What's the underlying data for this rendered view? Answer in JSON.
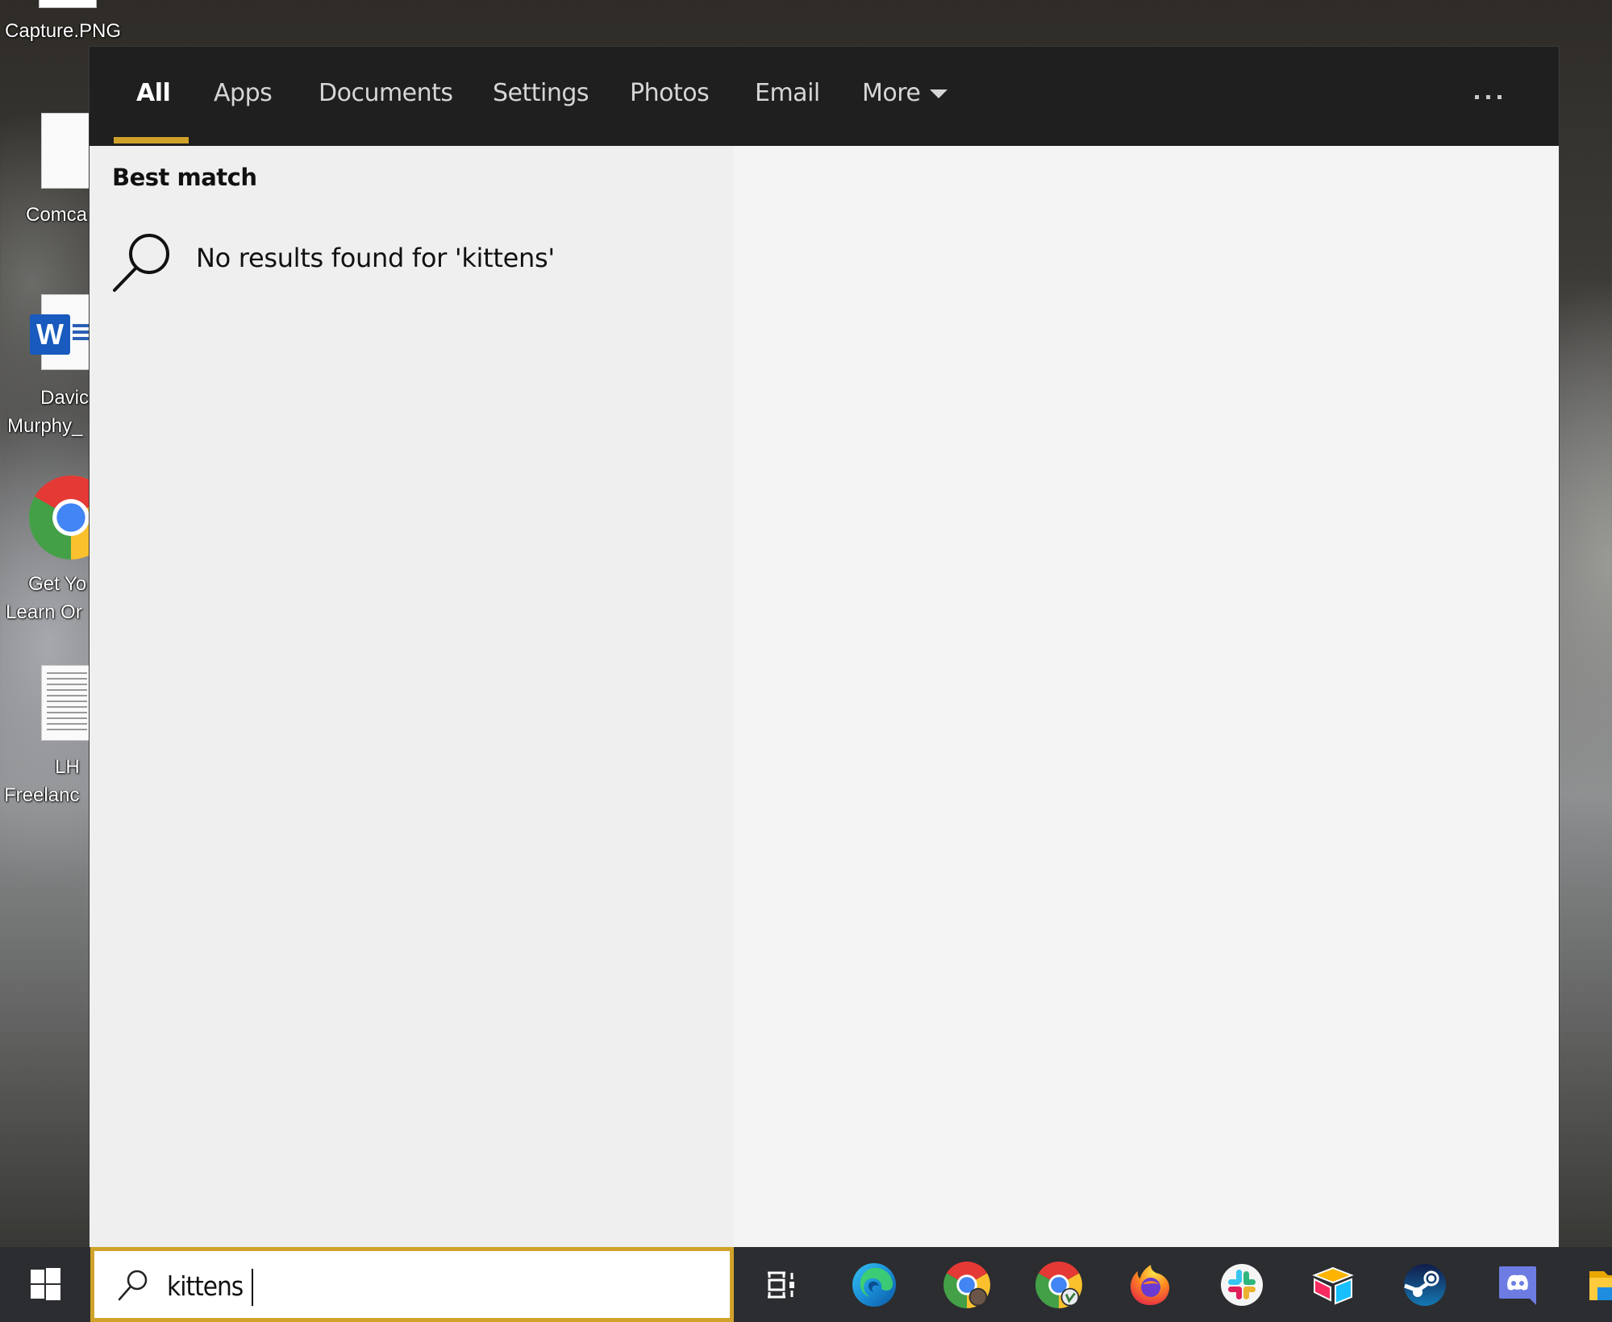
{
  "desktop": {
    "icons": [
      {
        "label": "Capture.PNG",
        "icon": "image-file-icon"
      },
      {
        "label": "Comca",
        "icon": "blank-document-icon"
      },
      {
        "label_line1": "Davic",
        "label_line2": "Murphy_",
        "icon": "word-document-icon"
      },
      {
        "label_line1": "Get Yo",
        "label_line2": "Learn Or",
        "icon": "chrome-shortcut-icon"
      },
      {
        "label_line1": "LH",
        "label_line2": "Freelanc",
        "icon": "text-document-icon"
      }
    ]
  },
  "search_panel": {
    "tabs": [
      {
        "label": "All",
        "active": true
      },
      {
        "label": "Apps",
        "active": false
      },
      {
        "label": "Documents",
        "active": false
      },
      {
        "label": "Settings",
        "active": false
      },
      {
        "label": "Photos",
        "active": false
      },
      {
        "label": "Email",
        "active": false
      },
      {
        "label": "More",
        "active": false,
        "icon": "caret-down-icon"
      }
    ],
    "more_options_icon": "ellipsis-icon",
    "best_match_heading": "Best match",
    "no_results_text": "No results found for 'kittens'",
    "no_results_icon": "search-icon",
    "accent_color": "#d0a22a"
  },
  "taskbar": {
    "start_icon": "windows-logo-icon",
    "search": {
      "value": "kittens",
      "icon": "search-icon"
    },
    "apps": [
      {
        "name": "Task View",
        "icon": "task-view-icon"
      },
      {
        "name": "Microsoft Edge",
        "icon": "edge-icon"
      },
      {
        "name": "Google Chrome (profile 1)",
        "icon": "chrome-icon"
      },
      {
        "name": "Google Chrome (profile 2)",
        "icon": "chrome-icon"
      },
      {
        "name": "Firefox",
        "icon": "firefox-icon"
      },
      {
        "name": "Slack",
        "icon": "slack-icon"
      },
      {
        "name": "Airtable",
        "icon": "airtable-icon"
      },
      {
        "name": "Steam",
        "icon": "steam-icon"
      },
      {
        "name": "Discord",
        "icon": "discord-icon"
      },
      {
        "name": "File Explorer",
        "icon": "folder-icon"
      }
    ],
    "background": "#2b2d30"
  }
}
